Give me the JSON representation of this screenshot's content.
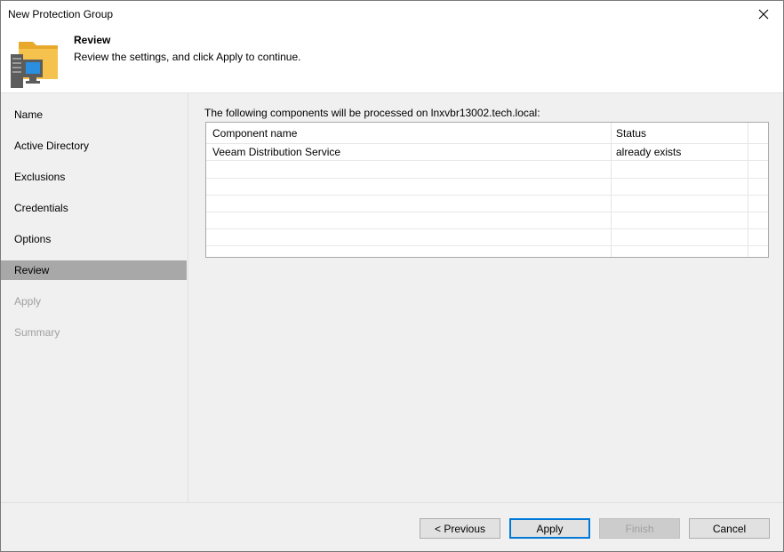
{
  "window": {
    "title": "New Protection Group"
  },
  "header": {
    "title": "Review",
    "subtitle": "Review the settings, and click Apply to continue.",
    "icon": "protection-group-folder-icon"
  },
  "sidebar": {
    "items": [
      {
        "label": "Name",
        "state": "normal"
      },
      {
        "label": "Active Directory",
        "state": "normal"
      },
      {
        "label": "Exclusions",
        "state": "normal"
      },
      {
        "label": "Credentials",
        "state": "normal"
      },
      {
        "label": "Options",
        "state": "normal"
      },
      {
        "label": "Review",
        "state": "active"
      },
      {
        "label": "Apply",
        "state": "disabled"
      },
      {
        "label": "Summary",
        "state": "disabled"
      }
    ]
  },
  "main": {
    "description": "The following components will be processed on lnxvbr13002.tech.local:",
    "table": {
      "columns": [
        "Component name",
        "Status"
      ],
      "rows": [
        [
          "Veeam Distribution Service",
          "already exists"
        ]
      ]
    }
  },
  "footer": {
    "previous_label": "< Previous",
    "apply_label": "Apply",
    "finish_label": "Finish",
    "cancel_label": "Cancel"
  },
  "colors": {
    "accent": "#0078d7",
    "selection": "#a8a8a8",
    "folder": "#f5c34d"
  }
}
